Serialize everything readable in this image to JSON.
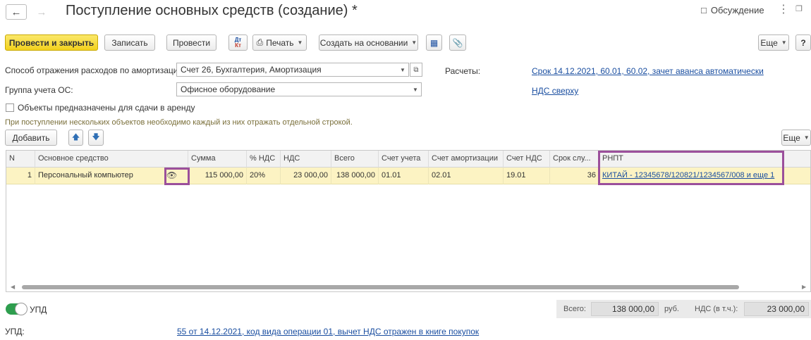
{
  "header": {
    "title": "Поступление основных средств (создание) *",
    "discussion_label": "Обсуждение"
  },
  "toolbar": {
    "post_and_close": "Провести и закрыть",
    "save": "Записать",
    "post": "Провести",
    "dt_kt": "Дт Кт",
    "print": "Печать",
    "create_based_on": "Создать на основании",
    "more": "Еще",
    "help": "?"
  },
  "form": {
    "depreciation_label": "Способ отражения расходов по амортизации:",
    "depreciation_value": "Счет 26, Бухгалтерия, Амортизация",
    "os_group_label": "Группа учета ОС:",
    "os_group_value": "Офисное оборудование",
    "lease_label": "Объекты предназначены для сдачи в аренду",
    "hint": "При поступлении нескольких объектов необходимо каждый из них отражать отдельной строкой.",
    "settlements_label": "Расчеты:",
    "settlements_link": "Срок 14.12.2021, 60.01, 60.02, зачет аванса автоматически",
    "vat_link": "НДС сверху"
  },
  "table_toolbar": {
    "add": "Добавить",
    "more": "Еще"
  },
  "table": {
    "columns": [
      "N",
      "Основное средство",
      "Сумма",
      "% НДС",
      "НДС",
      "Всего",
      "Счет учета",
      "Счет амортизации",
      "Счет НДС",
      "Срок слу...",
      "РНПТ"
    ],
    "rows": [
      {
        "n": "1",
        "asset": "Персональный компьютер",
        "sum": "115 000,00",
        "vat_rate": "20%",
        "vat": "23 000,00",
        "total": "138 000,00",
        "account": "01.01",
        "depr_account": "02.01",
        "vat_account": "19.01",
        "term": "36",
        "rnpt": "КИТАЙ - 12345678/120821/1234567/008 и еще 1"
      }
    ]
  },
  "footer": {
    "upd_toggle_label": "УПД",
    "upd_label": "УПД:",
    "upd_link": "55 от 14.12.2021, код вида операции 01, вычет НДС отражен в книге покупок",
    "total_label": "Всего:",
    "total_value": "138 000,00",
    "currency": "руб.",
    "vat_label": "НДС (в т.ч.):",
    "vat_value": "23 000,00"
  }
}
